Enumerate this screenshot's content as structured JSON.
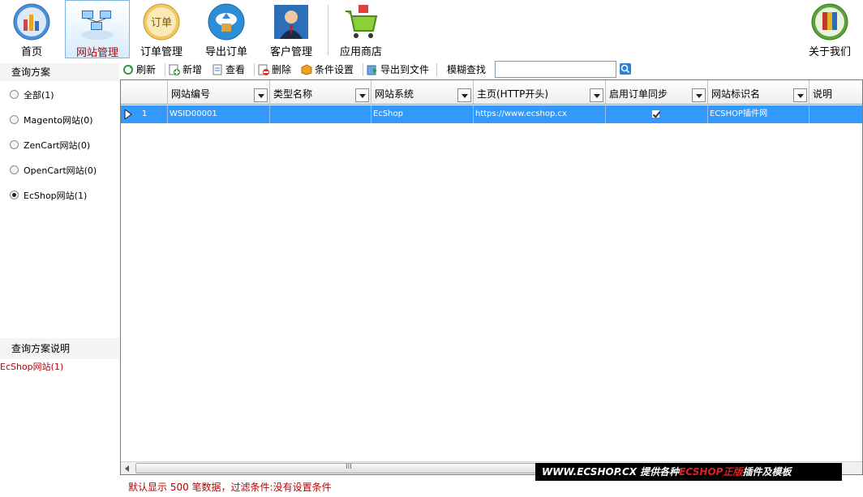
{
  "topbar": {
    "items": [
      {
        "label": "首页",
        "icon": "home-chart-icon"
      },
      {
        "label": "网站管理",
        "icon": "website-network-icon",
        "active": true
      },
      {
        "label": "订单管理",
        "icon": "order-note-icon"
      },
      {
        "label": "导出订单",
        "icon": "cloud-export-icon"
      },
      {
        "label": "客户管理",
        "icon": "customer-person-icon"
      },
      {
        "label": "应用商店",
        "icon": "shopping-cart-icon"
      }
    ],
    "about": "关于我们"
  },
  "toolbar": {
    "refresh": "刷新",
    "add": "新增",
    "view": "查看",
    "delete": "删除",
    "filter": "条件设置",
    "export": "导出到文件",
    "fuzzy_search_label": "模糊查找",
    "search_value": ""
  },
  "left_panel": {
    "title": "查询方案",
    "options": [
      {
        "label": "全部(1)",
        "checked": false
      },
      {
        "label": "Magento网站(0)",
        "checked": false
      },
      {
        "label": "ZenCart网站(0)",
        "checked": false
      },
      {
        "label": "OpenCart网站(0)",
        "checked": false
      },
      {
        "label": "EcShop网站(1)",
        "checked": true
      }
    ],
    "desc_title": "查询方案说明",
    "desc_text": "EcShop网站(1)"
  },
  "grid": {
    "columns": [
      "网站编号",
      "类型名称",
      "网站系统",
      "主页(HTTP开头)",
      "启用订单同步",
      "网站标识名",
      "说明"
    ],
    "rows": [
      {
        "index": "1",
        "site_id": "WSID00001",
        "type_name": "",
        "system": "EcShop",
        "homepage": "https://www.ecshop.cx",
        "sync": true,
        "site_name": "ECSHOP插件网",
        "note": ""
      }
    ],
    "scroll_grip": "III"
  },
  "status": "默认显示 500 笔数据，过滤条件:没有设置条件",
  "banner": {
    "part1": "WWW.ECSHOP.CX 提供各种",
    "part2": "ECSHOP正版",
    "part3": "插件及模板"
  },
  "colors": {
    "selected_row": "#3399ff",
    "accent_red": "#c00000"
  }
}
